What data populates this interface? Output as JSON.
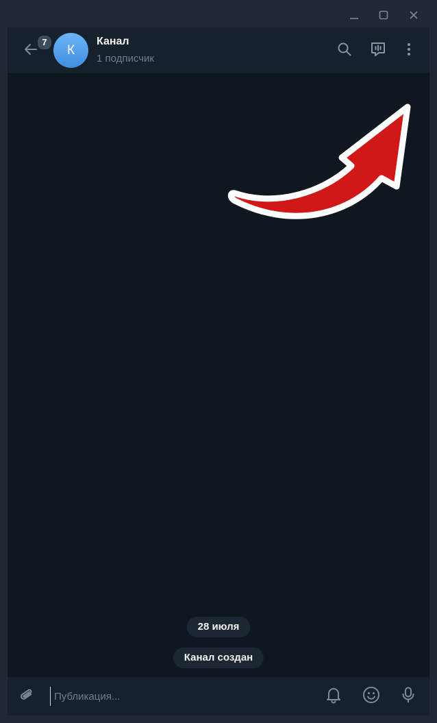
{
  "window": {
    "controls": [
      "minimize-icon",
      "maximize-icon",
      "close-icon"
    ]
  },
  "header": {
    "back_icon": "arrow-left-icon",
    "unread_count": "7",
    "avatar_letter": "К",
    "title": "Канал",
    "subtitle": "1 подписчик",
    "icons": [
      "search-icon",
      "live-stream-icon",
      "more-vertical-icon"
    ]
  },
  "chat": {
    "date_label": "28 июля",
    "service_message": "Канал создан"
  },
  "composer": {
    "attach_icon": "paperclip-icon",
    "placeholder": "Публикация...",
    "value": "",
    "icons": [
      "bell-icon",
      "emoji-icon",
      "microphone-icon"
    ]
  },
  "annotation": {
    "arrow_color": "#d01818",
    "arrow_outline": "#ffffff"
  },
  "colors": {
    "header_bg": "#17212b",
    "chat_bg": "#0f1720",
    "accent": "#4c9ae9",
    "muted_text": "#6d7f8f"
  }
}
